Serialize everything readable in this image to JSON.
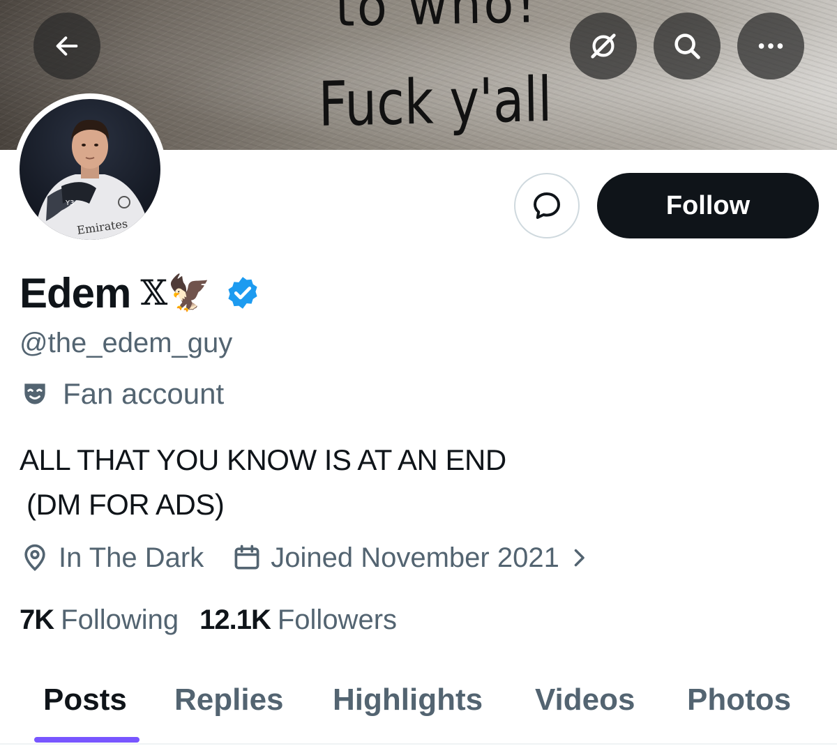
{
  "banner": {
    "text_line1": "to who!",
    "text_line2": "Fuck y'all"
  },
  "header": {
    "back_icon": "arrow-left-icon",
    "grok_icon": "grok-icon",
    "search_icon": "search-icon",
    "more_icon": "more-horizontal-icon"
  },
  "profile": {
    "avatar_shirt_text": "Emirates",
    "name": "Edem",
    "name_suffix_x": "𝕏",
    "name_suffix_emoji": "🦅",
    "verified_icon": "verified-badge-icon",
    "handle": "@the_edem_guy",
    "category_icon": "theater-masks-icon",
    "category": "Fan account",
    "bio_line1": "ALL THAT YOU KNOW IS AT AN END",
    "bio_line2": "(DM FOR ADS)",
    "location": "In The Dark",
    "joined": "Joined November 2021",
    "following_count": "7K",
    "following_label": "Following",
    "followers_count": "12.1K",
    "followers_label": "Followers"
  },
  "actions": {
    "message_icon": "message-bubble-icon",
    "follow_label": "Follow"
  },
  "tabs": [
    {
      "label": "Posts",
      "active": true
    },
    {
      "label": "Replies",
      "active": false
    },
    {
      "label": "Highlights",
      "active": false
    },
    {
      "label": "Videos",
      "active": false
    },
    {
      "label": "Photos",
      "active": false
    }
  ],
  "colors": {
    "text_primary": "#0f1419",
    "text_secondary": "#536471",
    "verified_blue": "#1d9bf0",
    "tab_indicator": "#7856ff",
    "follow_button": "#0f1419"
  }
}
